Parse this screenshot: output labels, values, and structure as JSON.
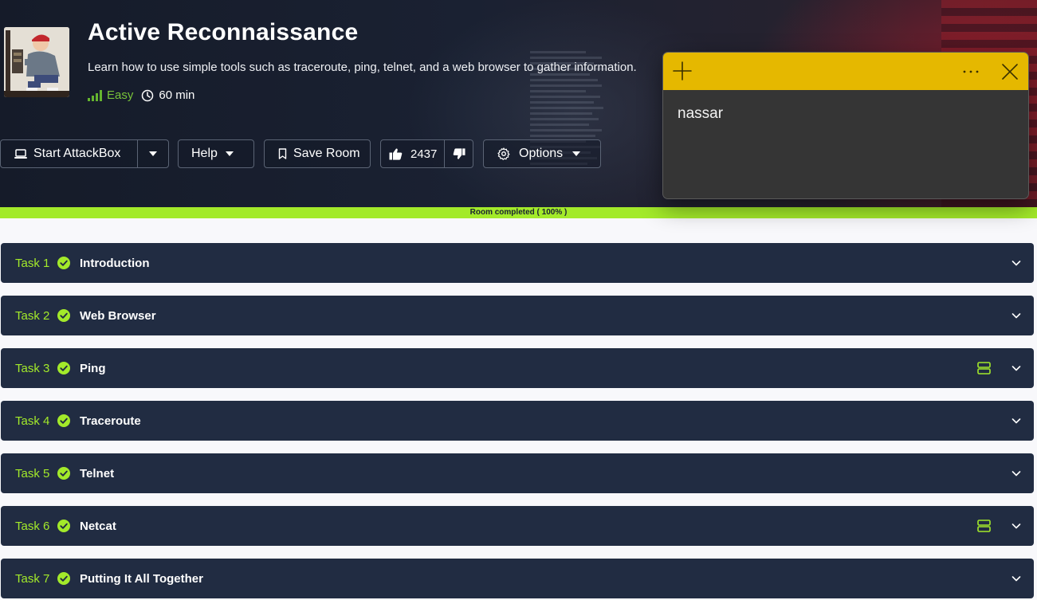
{
  "room": {
    "title": "Active Reconnaissance",
    "description": "Learn how to use simple tools such as traceroute, ping, telnet, and a web browser to gather information.",
    "difficulty": "Easy",
    "duration": "60 min"
  },
  "toolbar": {
    "start_attackbox": "Start AttackBox",
    "help": "Help",
    "save_room": "Save Room",
    "likes": "2437",
    "options": "Options"
  },
  "progress": {
    "label": "Room completed ( 100% )",
    "percent": 100
  },
  "tasks": [
    {
      "number": "Task 1",
      "title": "Introduction",
      "has_machine": false
    },
    {
      "number": "Task 2",
      "title": "Web Browser",
      "has_machine": false
    },
    {
      "number": "Task 3",
      "title": "Ping",
      "has_machine": true
    },
    {
      "number": "Task 4",
      "title": "Traceroute",
      "has_machine": false
    },
    {
      "number": "Task 5",
      "title": "Telnet",
      "has_machine": false
    },
    {
      "number": "Task 6",
      "title": "Netcat",
      "has_machine": true
    },
    {
      "number": "Task 7",
      "title": "Putting It All Together",
      "has_machine": false
    }
  ],
  "sticky_note": {
    "text": "nassar"
  },
  "colors": {
    "accent": "#a3ea2a",
    "task_bg": "#212c42",
    "sticky_header": "#e5b800"
  }
}
